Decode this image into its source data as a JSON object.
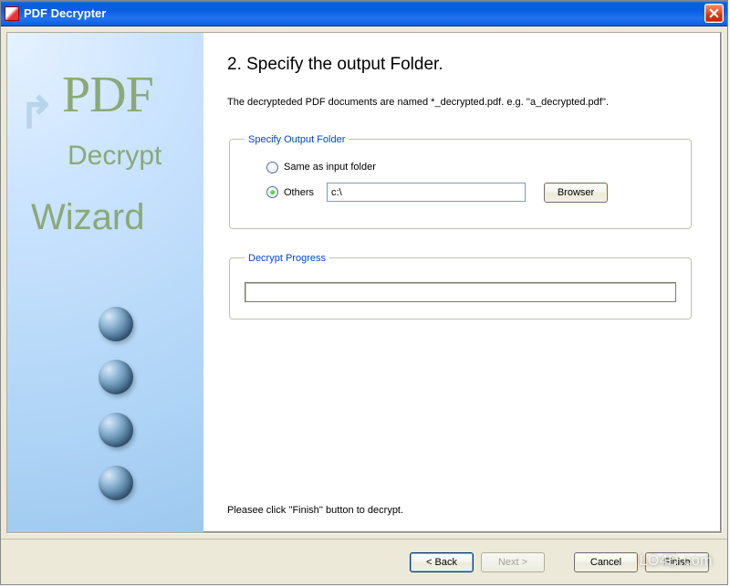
{
  "window": {
    "title": "PDF Decrypter"
  },
  "sidebar": {
    "line1": "PDF",
    "line2": "Decrypt",
    "line3": "Wizard"
  },
  "step": {
    "heading": "2. Specify the output Folder.",
    "description": "The decrypteded PDF documents are named  *_decrypted.pdf.   e.g. ''a_decrypted.pdf''."
  },
  "outputGroup": {
    "legend": "Specify Output Folder",
    "option_same": "Same as input folder",
    "option_others": "Others",
    "selected": "others",
    "path_value": "c:\\",
    "browse_label": "Browser"
  },
  "progressGroup": {
    "legend": "Decrypt Progress"
  },
  "hint": "Pleasee click ''Finish'' button to decrypt.",
  "buttons": {
    "back": "< Back",
    "next": "Next >",
    "cancel": "Cancel",
    "finish": "Finish"
  },
  "watermark": "LO4D.com"
}
